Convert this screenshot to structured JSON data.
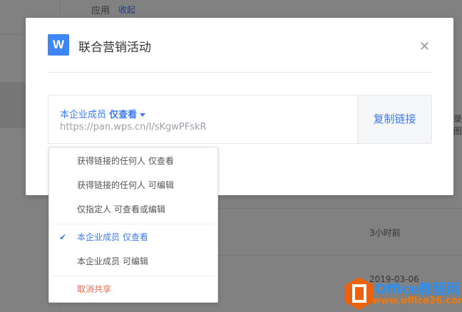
{
  "background": {
    "section_label": "应用",
    "collapse_link": "收起",
    "row1_time": "3小时前",
    "row2_date": "2019-03-06",
    "edge_text": "录图"
  },
  "modal": {
    "logo_letter": "W",
    "title": "联合营销活动",
    "close_icon": "close-icon",
    "permission": {
      "scope": "本企业成员",
      "level": "仅查看"
    },
    "url": "https://pan.wps.cn/l/sKgwPFskR",
    "copy_label": "复制链接"
  },
  "dropdown": {
    "items": [
      {
        "label": "获得链接的任何人 仅查看"
      },
      {
        "label": "获得链接的任何人 可编辑"
      },
      {
        "label": "仅指定人 可查看或编辑"
      },
      {
        "label": "本企业成员 仅查看",
        "selected": true
      },
      {
        "label": "本企业成员 可编辑"
      },
      {
        "label": "取消共享"
      }
    ]
  },
  "watermark": {
    "brand": "Office教程网",
    "site": "www.office26.com"
  },
  "colors": {
    "accent": "#3e7af0",
    "danger": "#f06b4f",
    "logo": "#3e86f5"
  }
}
